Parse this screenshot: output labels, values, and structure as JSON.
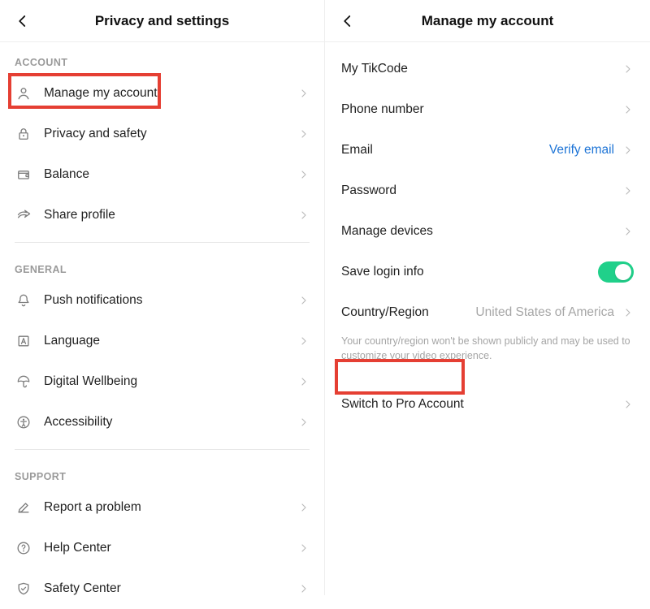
{
  "left": {
    "title": "Privacy and settings",
    "sections": {
      "account": {
        "heading": "ACCOUNT",
        "items": {
          "manage": "Manage my account",
          "privacy": "Privacy and safety",
          "balance": "Balance",
          "share": "Share profile"
        }
      },
      "general": {
        "heading": "GENERAL",
        "items": {
          "push": "Push notifications",
          "language": "Language",
          "wellbeing": "Digital Wellbeing",
          "accessibility": "Accessibility"
        }
      },
      "support": {
        "heading": "SUPPORT",
        "items": {
          "report": "Report a problem",
          "help": "Help Center",
          "safety": "Safety Center"
        }
      }
    }
  },
  "right": {
    "title": "Manage my account",
    "items": {
      "tikcode": "My TikCode",
      "phone": "Phone number",
      "email": {
        "label": "Email",
        "value": "Verify email"
      },
      "password": "Password",
      "devices": "Manage devices",
      "savelogin": "Save login info",
      "country": {
        "label": "Country/Region",
        "value": "United States of America",
        "note": "Your country/region won't be shown publicly and may be used to customize your video experience."
      },
      "switchpro": "Switch to Pro Account"
    }
  }
}
